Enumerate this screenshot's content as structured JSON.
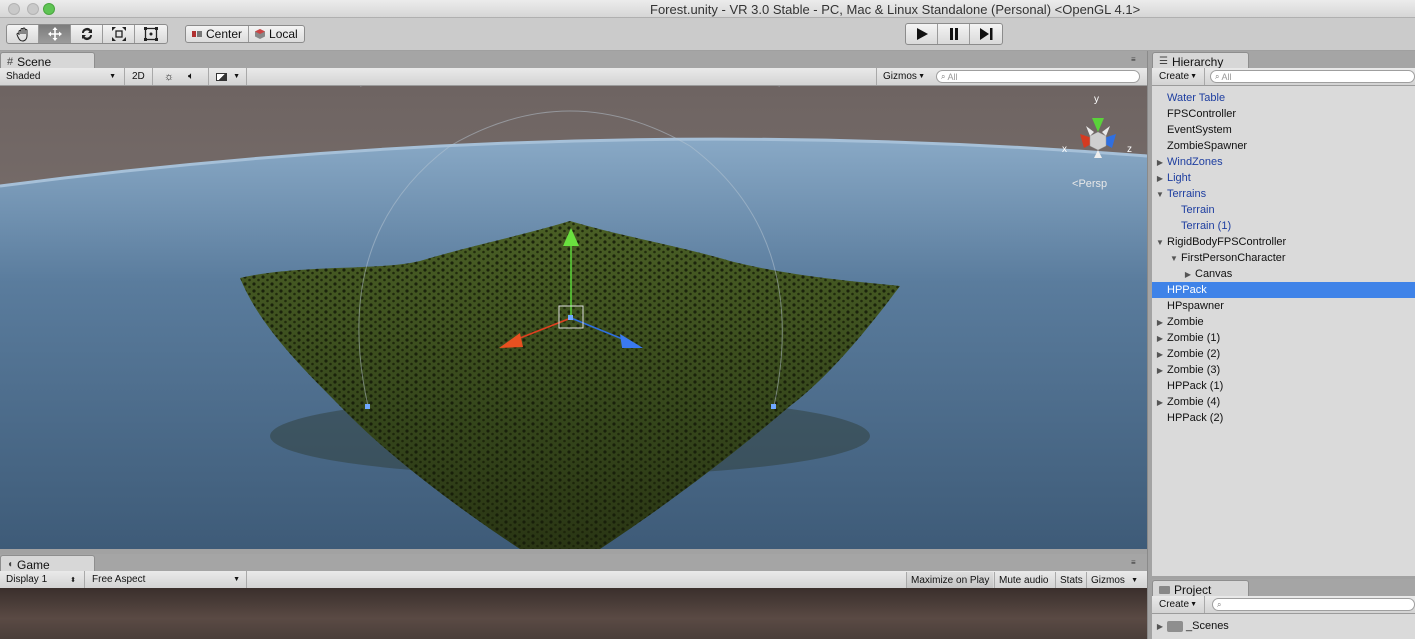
{
  "window": {
    "title": "Forest.unity - VR 3.0 Stable - PC, Mac & Linux Standalone (Personal) <OpenGL 4.1>"
  },
  "toolbar": {
    "tools": [
      "hand-tool",
      "move-tool",
      "rotate-tool",
      "scale-tool",
      "rect-tool"
    ],
    "active_tool": "move-tool",
    "pivot_label": "Center",
    "space_label": "Local"
  },
  "scene": {
    "tab_label": "Scene",
    "draw_mode": "Shaded",
    "mode_2d": "2D",
    "gizmos_label": "Gizmos",
    "search_placeholder": "All",
    "projection_label": "Persp",
    "axis_labels": {
      "x": "x",
      "y": "y",
      "z": "z"
    },
    "colors": {
      "sky": "#7c706c",
      "water": "#4f6d8c",
      "terrain": "#3d4f1f",
      "x_axis": "#e04020",
      "y_axis": "#50c030",
      "z_axis": "#2f6fe0"
    }
  },
  "game": {
    "tab_label": "Game",
    "display": "Display 1",
    "aspect": "Free Aspect",
    "maximize_label": "Maximize on Play",
    "mute_label": "Mute audio",
    "stats_label": "Stats",
    "gizmos_label": "Gizmos"
  },
  "hierarchy": {
    "tab_label": "Hierarchy",
    "create_label": "Create",
    "search_placeholder": "All",
    "items": [
      {
        "label": "Water Table",
        "indent": 0,
        "arrow": "",
        "blue": true
      },
      {
        "label": "FPSController",
        "indent": 0,
        "arrow": "",
        "blue": false
      },
      {
        "label": "EventSystem",
        "indent": 0,
        "arrow": "",
        "blue": false
      },
      {
        "label": "ZombieSpawner",
        "indent": 0,
        "arrow": "",
        "blue": false
      },
      {
        "label": "WindZones",
        "indent": 0,
        "arrow": "▶",
        "blue": true
      },
      {
        "label": "Light",
        "indent": 0,
        "arrow": "▶",
        "blue": true
      },
      {
        "label": "Terrains",
        "indent": 0,
        "arrow": "▼",
        "blue": true
      },
      {
        "label": "Terrain",
        "indent": 1,
        "arrow": "",
        "blue": true
      },
      {
        "label": "Terrain (1)",
        "indent": 1,
        "arrow": "",
        "blue": true
      },
      {
        "label": "RigidBodyFPSController",
        "indent": 0,
        "arrow": "▼",
        "blue": false
      },
      {
        "label": "FirstPersonCharacter",
        "indent": 1,
        "arrow": "▼",
        "blue": false
      },
      {
        "label": "Canvas",
        "indent": 2,
        "arrow": "▶",
        "blue": false
      },
      {
        "label": "HPPack",
        "indent": 0,
        "arrow": "",
        "blue": false,
        "selected": true
      },
      {
        "label": "HPspawner",
        "indent": 0,
        "arrow": "",
        "blue": false
      },
      {
        "label": "Zombie",
        "indent": 0,
        "arrow": "▶",
        "blue": false
      },
      {
        "label": "Zombie (1)",
        "indent": 0,
        "arrow": "▶",
        "blue": false
      },
      {
        "label": "Zombie (2)",
        "indent": 0,
        "arrow": "▶",
        "blue": false
      },
      {
        "label": "Zombie (3)",
        "indent": 0,
        "arrow": "▶",
        "blue": false
      },
      {
        "label": "HPPack (1)",
        "indent": 0,
        "arrow": "",
        "blue": false
      },
      {
        "label": "Zombie (4)",
        "indent": 0,
        "arrow": "▶",
        "blue": false
      },
      {
        "label": "HPPack (2)",
        "indent": 0,
        "arrow": "",
        "blue": false
      }
    ]
  },
  "project": {
    "tab_label": "Project",
    "create_label": "Create",
    "folders": [
      "_Scenes"
    ]
  }
}
